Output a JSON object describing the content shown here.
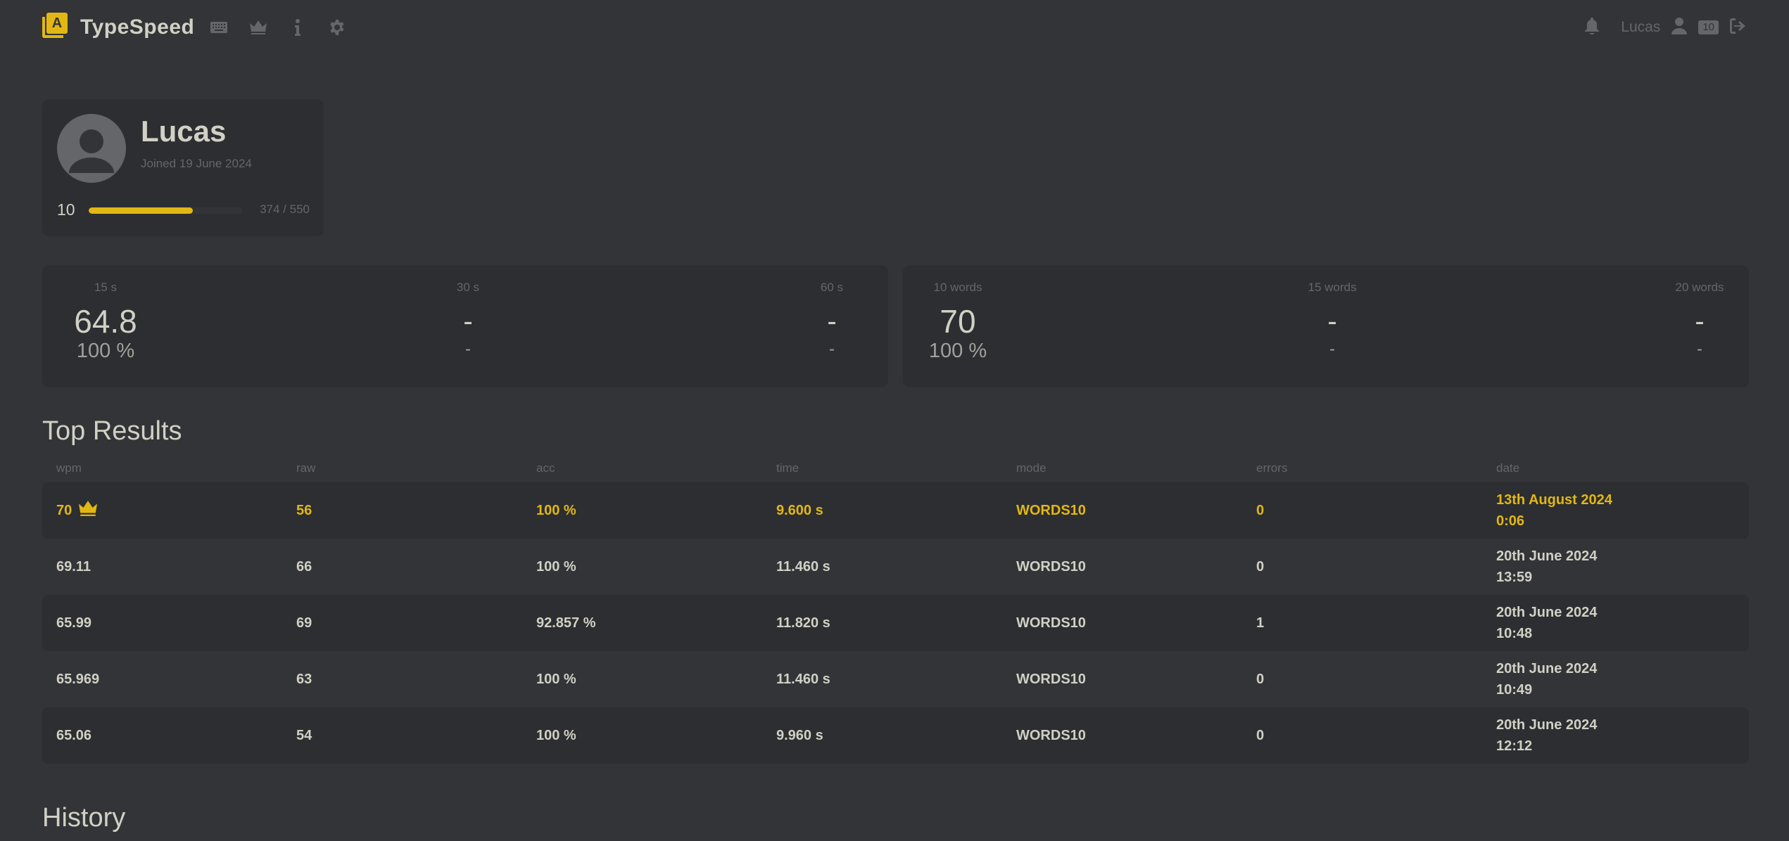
{
  "header": {
    "app_name": "TypeSpeed",
    "logo_letter": "A",
    "nav": [
      "keyboard-icon",
      "crown-icon",
      "info-icon",
      "settings-icon"
    ],
    "username": "Lucas",
    "level": "10",
    "right_icons": [
      "bell-icon",
      "user-icon",
      "logout-icon"
    ]
  },
  "profile": {
    "name": "Lucas",
    "joined": "Joined 19 June 2024",
    "level": "10",
    "xp_text": "374 / 550",
    "xp_fraction": 0.68
  },
  "time_stats": [
    {
      "label": "15 s",
      "wpm": "64.8",
      "acc": "100 %"
    },
    {
      "label": "30 s",
      "wpm": "-",
      "acc": "-"
    },
    {
      "label": "60 s",
      "wpm": "-",
      "acc": "-"
    }
  ],
  "word_stats": [
    {
      "label": "10 words",
      "wpm": "70",
      "acc": "100 %"
    },
    {
      "label": "15 words",
      "wpm": "-",
      "acc": "-"
    },
    {
      "label": "20 words",
      "wpm": "-",
      "acc": "-"
    }
  ],
  "top_results": {
    "title": "Top Results",
    "columns": [
      "wpm",
      "raw",
      "acc",
      "time",
      "mode",
      "errors",
      "date"
    ],
    "rows": [
      {
        "wpm": "70",
        "raw": "56",
        "acc": "100 %",
        "time": "9.600 s",
        "mode": "WORDS10",
        "errors": "0",
        "date": "13th August 2024",
        "clock": "0:06"
      },
      {
        "wpm": "69.11",
        "raw": "66",
        "acc": "100 %",
        "time": "11.460 s",
        "mode": "WORDS10",
        "errors": "0",
        "date": "20th June 2024",
        "clock": "13:59"
      },
      {
        "wpm": "65.99",
        "raw": "69",
        "acc": "92.857 %",
        "time": "11.820 s",
        "mode": "WORDS10",
        "errors": "1",
        "date": "20th June 2024",
        "clock": "10:48"
      },
      {
        "wpm": "65.969",
        "raw": "63",
        "acc": "100 %",
        "time": "11.460 s",
        "mode": "WORDS10",
        "errors": "0",
        "date": "20th June 2024",
        "clock": "10:49"
      },
      {
        "wpm": "65.06",
        "raw": "54",
        "acc": "100 %",
        "time": "9.960 s",
        "mode": "WORDS10",
        "errors": "0",
        "date": "20th June 2024",
        "clock": "12:12"
      }
    ]
  },
  "history": {
    "title": "History"
  },
  "colors": {
    "background": "#323437",
    "card": "#2c2e31",
    "accent": "#e2b714",
    "text": "#d1d0c5",
    "muted": "#646669"
  }
}
